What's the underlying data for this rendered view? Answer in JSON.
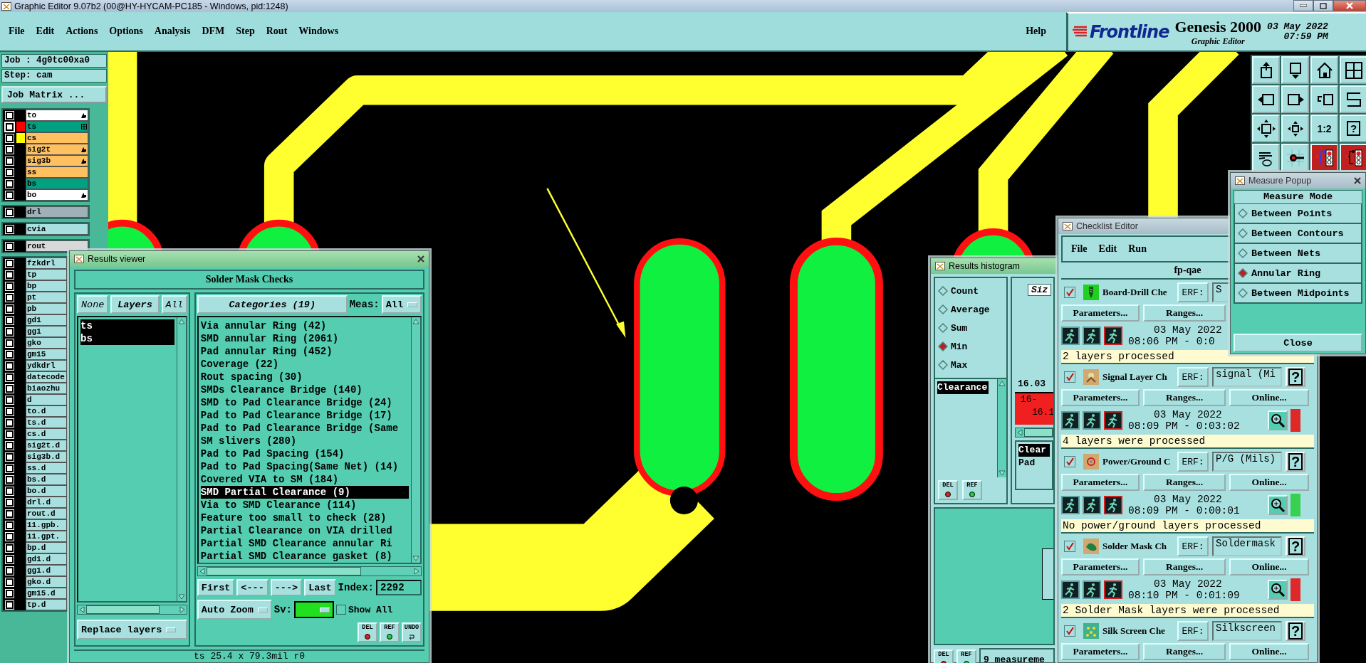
{
  "window": {
    "title": "Graphic Editor 9.07b2 (00@HY-HYCAM-PC185 - Windows, pid:1248)"
  },
  "menu": [
    "File",
    "Edit",
    "Actions",
    "Options",
    "Analysis",
    "DFM",
    "Step",
    "Rout",
    "Windows"
  ],
  "help": "Help",
  "logo": {
    "brand": "Frontline",
    "product": "Genesis 2000",
    "subtitle": "Graphic Editor",
    "date": "03 May 2022",
    "time": "07:59 PM"
  },
  "toolbar": {
    "ratio": "1:2",
    "help": "?"
  },
  "job": {
    "job": "Job : 4g0tc00xa0",
    "step": "Step: cam",
    "matrix_button": "Job Matrix ..."
  },
  "layer_groups": [
    {
      "layers": [
        {
          "name": "to",
          "color": "#ffffff",
          "checked": false,
          "work": false,
          "pointer": true,
          "grid": false
        },
        {
          "name": "ts",
          "color": "#00a080",
          "display": {
            "color": "#ff0000"
          },
          "checked": false,
          "work": true,
          "pointer": false,
          "grid": true
        },
        {
          "name": "cs",
          "color": "#ffc060",
          "display": {
            "color": "#ffff00"
          },
          "checked": false,
          "work": false,
          "pointer": false,
          "grid": false
        },
        {
          "name": "sig2t",
          "color": "#ffc060",
          "checked": false,
          "work": false,
          "pointer": true,
          "grid": false
        },
        {
          "name": "sig3b",
          "color": "#ffc060",
          "checked": false,
          "work": false,
          "pointer": true,
          "grid": false
        },
        {
          "name": "ss",
          "color": "#ffc060",
          "checked": false,
          "work": false,
          "pointer": false,
          "grid": false
        },
        {
          "name": "bs",
          "color": "#00a080",
          "checked": false,
          "work": false,
          "pointer": false,
          "grid": false
        },
        {
          "name": "bo",
          "color": "#ffffff",
          "checked": false,
          "work": false,
          "pointer": true,
          "grid": false
        }
      ]
    },
    {
      "layers": [
        {
          "name": "drl",
          "color": "#a0b0b8",
          "checked": false
        }
      ]
    },
    {
      "layers": [
        {
          "name": "cvia",
          "color": "#a8e0e0",
          "checked": false
        }
      ]
    },
    {
      "layers": [
        {
          "name": "rout",
          "color": "#d8d8d8",
          "checked": false
        }
      ]
    },
    {
      "layers": [
        {
          "name": "fzkdrl",
          "color": "#a8e0e0",
          "checked": false
        },
        {
          "name": "tp",
          "color": "#a8e0e0",
          "checked": false
        },
        {
          "name": "bp",
          "color": "#a8e0e0",
          "checked": false
        },
        {
          "name": "pt",
          "color": "#a8e0e0",
          "checked": false
        },
        {
          "name": "pb",
          "color": "#a8e0e0",
          "checked": false
        },
        {
          "name": "gd1",
          "color": "#a8e0e0",
          "checked": false
        },
        {
          "name": "gg1",
          "color": "#a8e0e0",
          "checked": false
        },
        {
          "name": "gko",
          "color": "#a8e0e0",
          "checked": false
        },
        {
          "name": "gm15",
          "color": "#a8e0e0",
          "checked": false
        },
        {
          "name": "ydkdrl",
          "color": "#a8e0e0",
          "checked": false
        },
        {
          "name": "datecode",
          "color": "#a8e0e0",
          "checked": false
        },
        {
          "name": "biaozhu",
          "color": "#a8e0e0",
          "checked": false
        },
        {
          "name": "d",
          "color": "#a8e0e0",
          "checked": false
        },
        {
          "name": "to.d",
          "color": "#a8e0e0",
          "checked": false
        },
        {
          "name": "ts.d",
          "color": "#a8e0e0",
          "checked": false
        },
        {
          "name": "cs.d",
          "color": "#a8e0e0",
          "checked": false
        },
        {
          "name": "sig2t.d",
          "color": "#a8e0e0",
          "checked": false
        },
        {
          "name": "sig3b.d",
          "color": "#a8e0e0",
          "checked": false
        },
        {
          "name": "ss.d",
          "color": "#a8e0e0",
          "checked": false
        },
        {
          "name": "bs.d",
          "color": "#a8e0e0",
          "checked": false
        },
        {
          "name": "bo.d",
          "color": "#a8e0e0",
          "checked": false
        },
        {
          "name": "drl.d",
          "color": "#a8e0e0",
          "checked": false
        },
        {
          "name": "rout.d",
          "color": "#a8e0e0",
          "checked": false
        },
        {
          "name": "11.gpb.",
          "color": "#a8e0e0",
          "checked": false
        },
        {
          "name": "11.gpt.",
          "color": "#a8e0e0",
          "checked": false
        },
        {
          "name": "bp.d",
          "color": "#a8e0e0",
          "checked": false
        },
        {
          "name": "gd1.d",
          "color": "#a8e0e0",
          "checked": false
        },
        {
          "name": "gg1.d",
          "color": "#a8e0e0",
          "checked": false
        },
        {
          "name": "gko.d",
          "color": "#a8e0e0",
          "checked": false
        },
        {
          "name": "gm15.d",
          "color": "#a8e0e0",
          "checked": false
        },
        {
          "name": "tp.d",
          "color": "#a8e0e0",
          "checked": false
        }
      ]
    }
  ],
  "results_viewer": {
    "title": "Results viewer",
    "heading": "Solder Mask Checks",
    "layer_buttons": [
      "None",
      "Layers",
      "All"
    ],
    "layers": [
      {
        "name": "ts",
        "selected": true
      },
      {
        "name": "bs",
        "selected": true
      }
    ],
    "categories_button": "Categories (19)",
    "meas_label": "Meas:",
    "meas_value": "All",
    "categories": [
      {
        "label": "Via annular Ring (42)",
        "selected": false
      },
      {
        "label": "SMD annular Ring (2061)",
        "selected": false
      },
      {
        "label": "Pad annular Ring (452)",
        "selected": false
      },
      {
        "label": "Coverage (22)",
        "selected": false
      },
      {
        "label": "Rout spacing (30)",
        "selected": false
      },
      {
        "label": "SMDs Clearance Bridge (140)",
        "selected": false
      },
      {
        "label": "SMD to Pad Clearance Bridge (24)",
        "selected": false
      },
      {
        "label": "Pad to Pad Clearance Bridge (17)",
        "selected": false
      },
      {
        "label": "Pad to Pad Clearance Bridge (Same",
        "selected": false
      },
      {
        "label": "SM slivers (280)",
        "selected": false
      },
      {
        "label": "Pad to Pad Spacing (154)",
        "selected": false
      },
      {
        "label": "Pad to Pad Spacing(Same Net) (14)",
        "selected": false
      },
      {
        "label": "Covered VIA to SM (184)",
        "selected": false
      },
      {
        "label": "SMD Partial Clearance (9)",
        "selected": true
      },
      {
        "label": "Via to SMD Clearance (114)",
        "selected": false
      },
      {
        "label": "Feature too small to check (28)",
        "selected": false
      },
      {
        "label": "Partial Clearance on VIA drilled",
        "selected": false
      },
      {
        "label": "Partial SMD Clearance annular Ri",
        "selected": false
      },
      {
        "label": "Partial SMD Clearance gasket (8)",
        "selected": false
      }
    ],
    "nav_buttons": [
      "First",
      "<---",
      "--->",
      "Last"
    ],
    "index_label": "Index:",
    "index": "2292",
    "zoom_mode": "Auto Zoom",
    "sv_label": "Sv:",
    "sv": {
      "color": "#20e020"
    },
    "show_all": {
      "label": "Show All",
      "checked": false
    },
    "tool_buttons": [
      "DEL",
      "REF",
      "UNDO"
    ],
    "replace": "Replace layers",
    "status": "ts 25.4 x 79.3mil r0"
  },
  "histogram": {
    "title": "Results histogram",
    "modes": [
      {
        "label": "Count",
        "selected": false
      },
      {
        "label": "Average",
        "selected": false
      },
      {
        "label": "Sum",
        "selected": false
      },
      {
        "label": "Min",
        "selected": true
      },
      {
        "label": "Max",
        "selected": false
      }
    ],
    "measures": [
      {
        "label": "Clearance",
        "selected": true
      }
    ],
    "size_label": "Siz",
    "bar_value": "16.03",
    "bar_range": [
      "16-",
      "16.1"
    ],
    "list": [
      {
        "label": "Clear",
        "selected": true
      },
      {
        "label": "Pad",
        "selected": false
      }
    ],
    "tool_buttons": [
      "DEL",
      "REF"
    ],
    "footer_buttons": [
      "DEL",
      "REF"
    ],
    "count": "9 measureme"
  },
  "checklist": {
    "title": "Checklist Editor",
    "menu": [
      "File",
      "Edit",
      "Run"
    ],
    "name": "fp-qae",
    "checks": [
      {
        "name": "Board-Drill Che",
        "checked": true,
        "erf_label": "ERF:",
        "erf": "S",
        "buttons": [
          "Parameters...",
          "Ranges..."
        ],
        "date": "03 May 2022",
        "time": "08:06 PM - 0:0",
        "message": "2 layers processed"
      },
      {
        "name": "Signal Layer Ch",
        "checked": true,
        "erf_label": "ERF:",
        "erf": "signal (Mi",
        "help": "?",
        "buttons": [
          "Parameters...",
          "Ranges...",
          "Online..."
        ],
        "date": "03 May 2022",
        "time": "08:09 PM - 0:03:02",
        "color": "#e02828",
        "message": "4 layers were processed"
      },
      {
        "name": "Power/Ground C",
        "checked": true,
        "erf_label": "ERF:",
        "erf": "P/G (Mils)",
        "help": "?",
        "buttons": [
          "Parameters...",
          "Ranges...",
          "Online..."
        ],
        "date": "03 May 2022",
        "time": "08:09 PM - 0:00:01",
        "color": "#38d050",
        "message": "No power/ground layers processed"
      },
      {
        "name": "Solder Mask Ch",
        "checked": true,
        "erf_label": "ERF:",
        "erf": "Soldermask",
        "help": "?",
        "buttons": [
          "Parameters...",
          "Ranges...",
          "Online..."
        ],
        "date": "03 May 2022",
        "time": "08:10 PM - 0:01:09",
        "color": "#e02828",
        "message": "2 Solder Mask layers were processed"
      },
      {
        "name": "Silk Screen Che",
        "checked": true,
        "erf_label": "ERF:",
        "erf": "Silkscreen",
        "help": "?",
        "buttons": [
          "Parameters...",
          "Ranges...",
          "Online..."
        ]
      }
    ]
  },
  "measure_popup": {
    "title": "Measure Popup",
    "heading": "Measure Mode",
    "modes": [
      {
        "label": "Between Points",
        "selected": false
      },
      {
        "label": "Between Contours",
        "selected": false
      },
      {
        "label": "Between Nets",
        "selected": false
      },
      {
        "label": "Annular Ring",
        "selected": true
      },
      {
        "label": "Between Midpoints",
        "selected": false
      }
    ],
    "close": "Close"
  }
}
